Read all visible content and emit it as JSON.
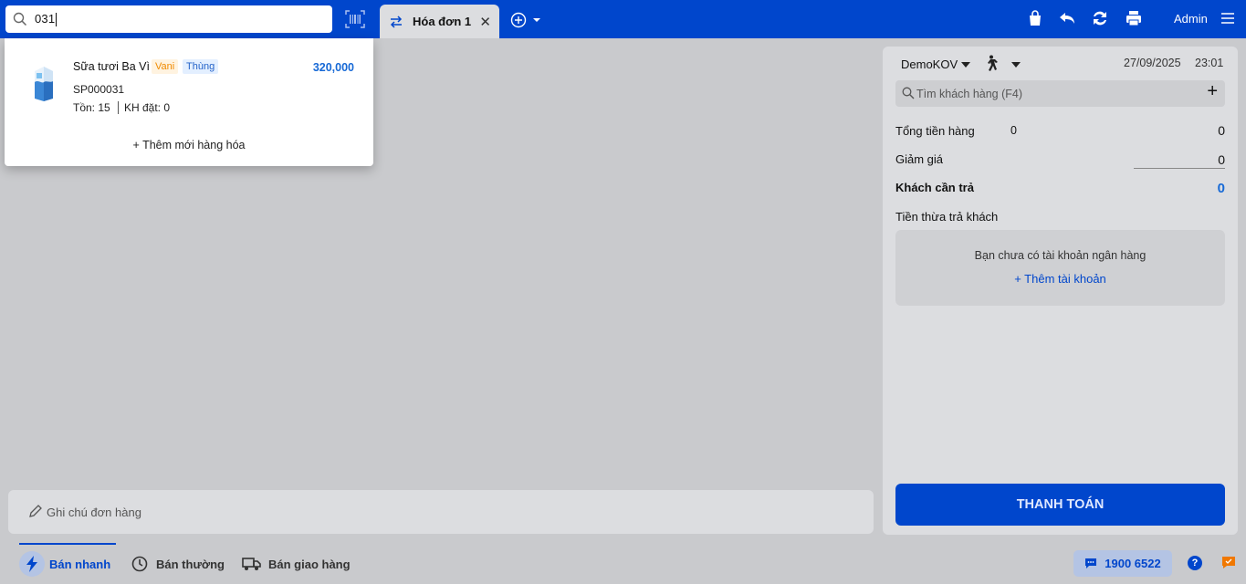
{
  "search": {
    "value": "031"
  },
  "tabs": [
    {
      "label": "Hóa đơn 1"
    }
  ],
  "header": {
    "user": "Admin"
  },
  "dropdown": {
    "product": {
      "name": "Sữa tươi Ba Vì",
      "badges": [
        "Vani",
        "Thùng"
      ],
      "price": "320,000",
      "code": "SP000031",
      "stock": "Tồn: 15",
      "ordered": "KH đặt: 0"
    },
    "add_new": "+ Thêm mới hàng hóa"
  },
  "panel": {
    "store": "DemoKOV",
    "date": "27/09/2025",
    "time": "23:01",
    "customer_search_placeholder": "Tìm khách hàng (F4)",
    "total_label": "Tổng tiền hàng",
    "total_qty": "0",
    "total_value": "0",
    "discount_label": "Giảm giá",
    "discount_value": "0",
    "payable_label": "Khách cần trả",
    "payable_value": "0",
    "change_label": "Tiền thừa trả khách",
    "bank_message": "Bạn chưa có tài khoản ngân hàng",
    "bank_add": "Thêm tài khoản",
    "pay_button": "THANH TOÁN"
  },
  "note": {
    "placeholder": "Ghi chú đơn hàng"
  },
  "bottom": {
    "modes": [
      "Bán nhanh",
      "Bán thường",
      "Bán giao hàng"
    ],
    "hotline": "1900 6522"
  },
  "colors": {
    "brand": "#0046cc",
    "price": "#1769d6",
    "badge_orange": "#f08a00"
  },
  "icons": [
    "search-icon",
    "barcode-scan-icon",
    "swap-icon",
    "close-icon",
    "add-circle-icon",
    "bag-icon",
    "undo-icon",
    "refresh-icon",
    "printer-icon",
    "menu-icon",
    "walk-icon",
    "pencil-icon",
    "lightning-icon",
    "clock-icon",
    "truck-icon",
    "chat-icon",
    "help-icon",
    "feedback-icon"
  ]
}
